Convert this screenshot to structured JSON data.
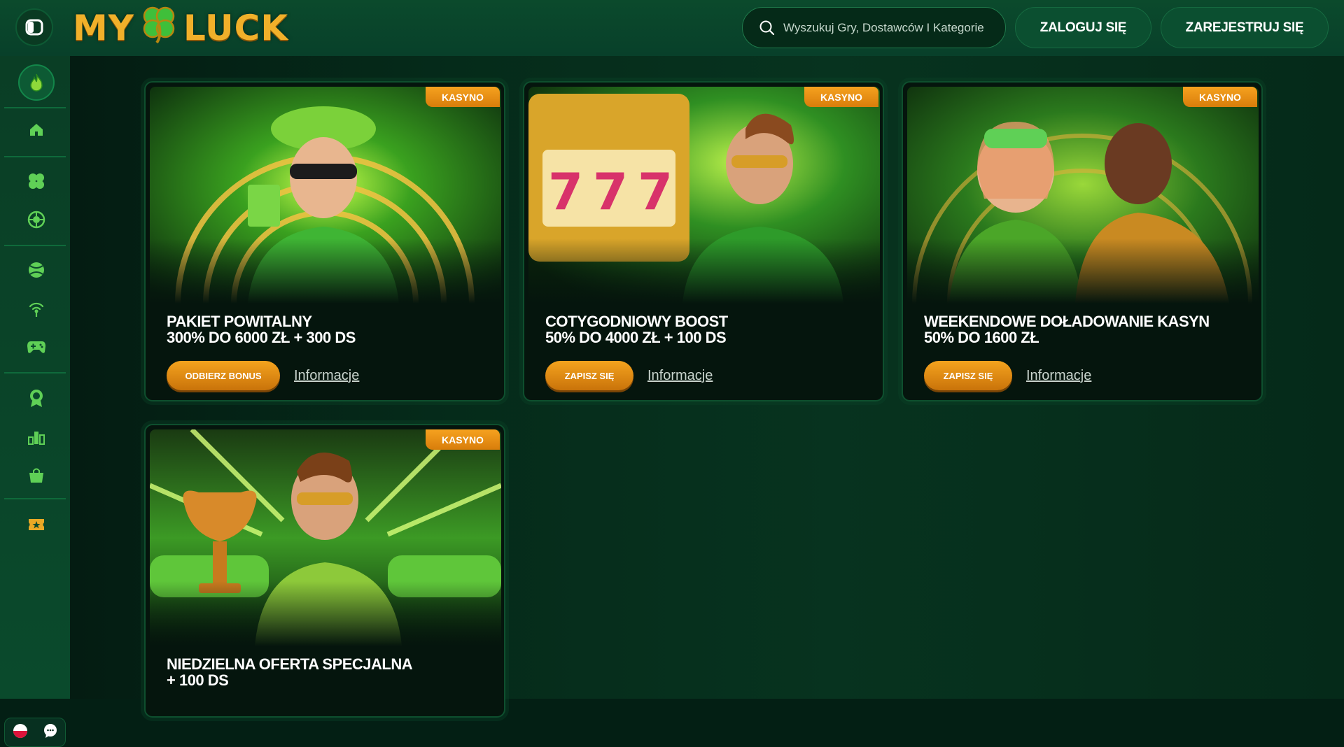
{
  "header": {
    "logo_left": "MY",
    "logo_right": "LUCK",
    "search_placeholder": "Wyszukuj Gry, Dostawców I Kategorie",
    "login_label": "ZALOGUJ SIĘ",
    "register_label": "ZAREJESTRUJ SIĘ"
  },
  "sidebar": {
    "items": [
      "flame-icon",
      "home-icon",
      "clover-icon",
      "roulette-icon",
      "sports-ball-icon",
      "live-signal-icon",
      "gamepad-icon",
      "award-icon",
      "leaderboard-icon",
      "shop-icon",
      "ticket-icon"
    ]
  },
  "colors": {
    "accent": "#f1b02a",
    "button_orange": "#e28a12",
    "background": "#031f14"
  },
  "promos": [
    {
      "badge": "KASYNO",
      "title_line1": "PAKIET POWITALNY",
      "title_line2": "300% DO 6000 ZŁ + 300 DS",
      "cta": "ODBIERZ BONUS",
      "info": "Informacje"
    },
    {
      "badge": "KASYNO",
      "title_line1": "COTYGODNIOWY BOOST",
      "title_line2": "50% DO 4000 ZŁ + 100 DS",
      "cta": "ZAPISZ SIĘ",
      "info": "Informacje"
    },
    {
      "badge": "KASYNO",
      "title_line1": "WEEKENDOWE DOŁADOWANIE KASYN",
      "title_line2": "50% DO 1600 ZŁ",
      "cta": "ZAPISZ SIĘ",
      "info": "Informacje"
    },
    {
      "badge": "KASYNO",
      "title_line1": "NIEDZIELNA OFERTA SPECJALNA",
      "title_line2": "+ 100 DS"
    }
  ]
}
